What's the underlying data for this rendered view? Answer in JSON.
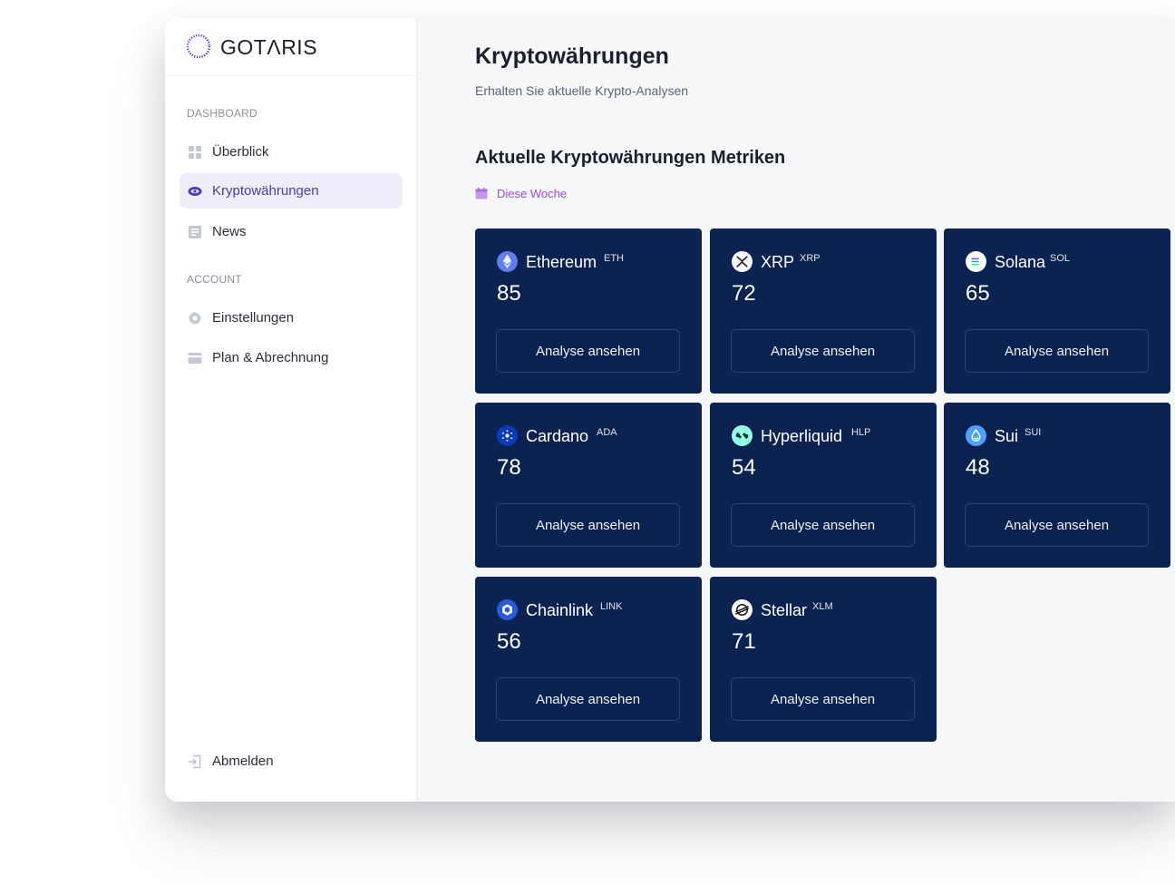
{
  "brand": {
    "name": "GOTΛRIS"
  },
  "sidebar": {
    "section_dashboard": "DASHBOARD",
    "section_account": "ACCOUNT",
    "items": [
      {
        "label": "Überblick",
        "icon": "grid-icon"
      },
      {
        "label": "Kryptowährungen",
        "icon": "eye-icon",
        "active": true
      },
      {
        "label": "News",
        "icon": "newspaper-icon"
      }
    ],
    "account_items": [
      {
        "label": "Einstellungen",
        "icon": "gear-icon"
      },
      {
        "label": "Plan & Abrechnung",
        "icon": "credit-card-icon"
      }
    ],
    "logout": {
      "label": "Abmelden",
      "icon": "logout-icon"
    }
  },
  "main": {
    "title": "Kryptowährungen",
    "subtitle": "Erhalten Sie aktuelle Krypto-Analysen",
    "section_title": "Aktuelle Kryptowährungen Metriken",
    "period": {
      "label": "Diese Woche",
      "icon": "calendar-icon"
    },
    "colors": {
      "card_bg": "#0c2250",
      "accent": "#9b4be0",
      "active_nav": "#4b3bb5"
    },
    "cards": [
      {
        "name": "Ethereum",
        "ticker": "ETH",
        "score": "85",
        "button": "Analyse ansehen",
        "icon": "ethereum-icon"
      },
      {
        "name": "XRP",
        "ticker": "XRP",
        "score": "72",
        "button": "Analyse ansehen",
        "icon": "xrp-icon"
      },
      {
        "name": "Solana",
        "ticker": "SOL",
        "score": "65",
        "button": "Analyse ansehen",
        "icon": "solana-icon"
      },
      {
        "name": "Cardano",
        "ticker": "ADA",
        "score": "78",
        "button": "Analyse ansehen",
        "icon": "cardano-icon"
      },
      {
        "name": "Hyperliquid",
        "ticker": "HLP",
        "score": "54",
        "button": "Analyse ansehen",
        "icon": "hyperliquid-icon"
      },
      {
        "name": "Sui",
        "ticker": "SUI",
        "score": "48",
        "button": "Analyse ansehen",
        "icon": "sui-icon"
      },
      {
        "name": "Chainlink",
        "ticker": "LINK",
        "score": "56",
        "button": "Analyse ansehen",
        "icon": "chainlink-icon"
      },
      {
        "name": "Stellar",
        "ticker": "XLM",
        "score": "71",
        "button": "Analyse ansehen",
        "icon": "stellar-icon"
      }
    ]
  }
}
